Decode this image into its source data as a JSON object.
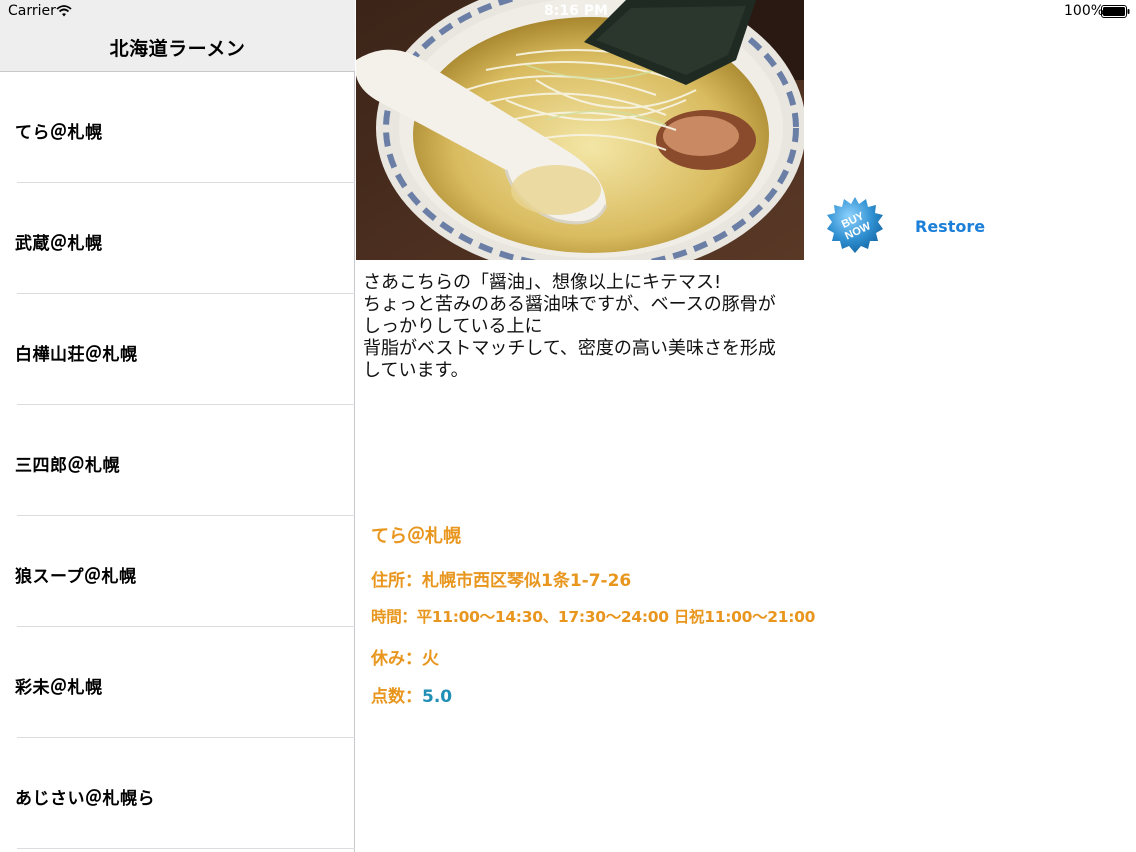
{
  "status_bar": {
    "carrier": "Carrier",
    "time": "8:16 PM",
    "battery": "100%"
  },
  "master": {
    "title": "北海道ラーメン",
    "items": [
      {
        "label": "てら＠札幌"
      },
      {
        "label": "武蔵＠札幌"
      },
      {
        "label": "白樺山荘＠札幌"
      },
      {
        "label": "三四郎＠札幌"
      },
      {
        "label": "狼スープ＠札幌"
      },
      {
        "label": "彩未＠札幌"
      },
      {
        "label": "あじさい＠札幌ら"
      }
    ]
  },
  "detail": {
    "description_lines": [
      "さあこちらの「醤油」、想像以上にキテマス!",
      "ちょっと苦みのある醤油味ですが、ベースの豚骨が",
      "しっかりしている上に",
      "背脂がベストマッチして、密度の高い美味さを形成",
      "しています。"
    ],
    "shop_name": "てら＠札幌",
    "address": "住所：札幌市西区琴似1条1-7-26",
    "hours": "時間：平11:00〜14:30、17:30〜24:00 日祝11:00〜21:00",
    "holiday": "休み：火",
    "score_label": "点数：",
    "score_value": "5.0"
  },
  "store": {
    "buy_now_line1": "BUY",
    "buy_now_line2": "NOW",
    "restore_label": "Restore"
  },
  "colors": {
    "info_text": "#e8961e",
    "score_value": "#1f8fb5",
    "restore_link": "#1c7fd8",
    "buy_badge": "#2f8fd0"
  }
}
